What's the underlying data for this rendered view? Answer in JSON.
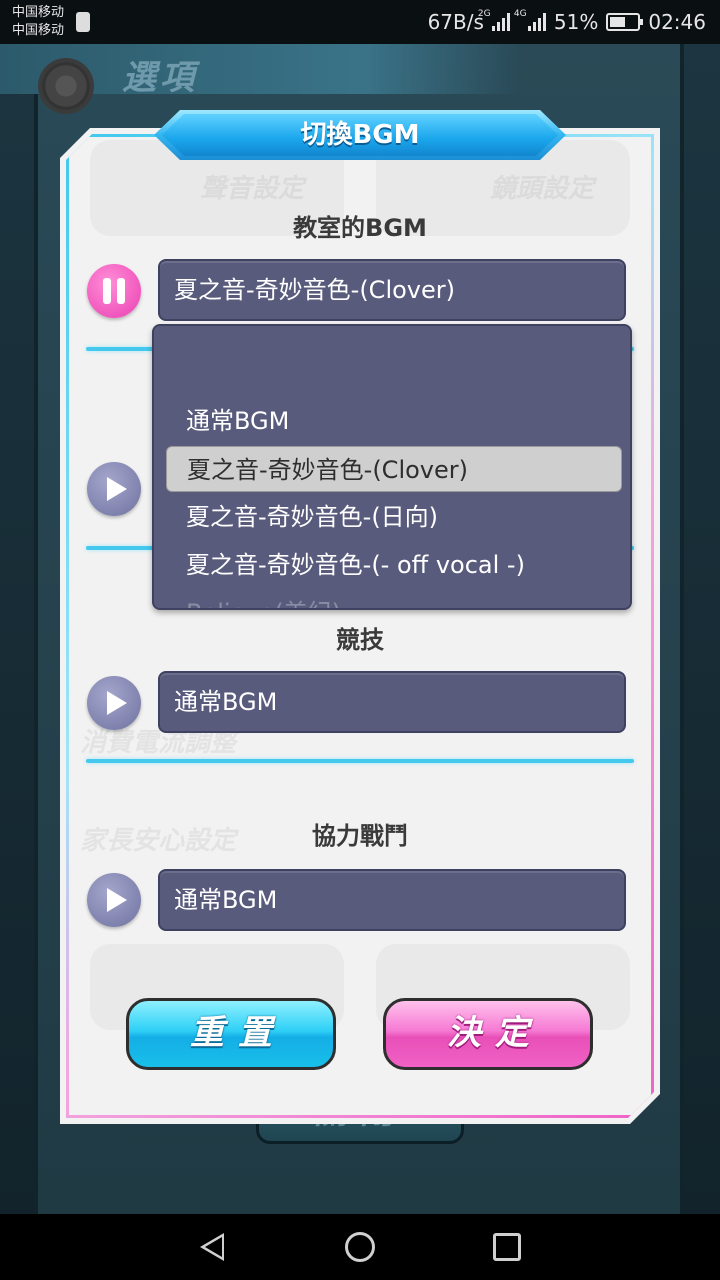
{
  "status_bar": {
    "carrier1": "中国移动",
    "carrier2": "中国移动",
    "net_speed": "67B/s",
    "signal1_tag": "2G",
    "signal2_tag": "4G",
    "battery": "51%",
    "time": "02:46"
  },
  "game": {
    "header_title": "選項",
    "close_label": "關閉",
    "ghost_labels": [
      "聲音設定",
      "鏡頭設定",
      "消費電流調整",
      "家長安心設定"
    ]
  },
  "dialog": {
    "title": "切換BGM",
    "sections": [
      {
        "label": "教室的BGM",
        "value": "夏之音-奇妙音色-(Clover)",
        "state": "playing"
      },
      {
        "label": "",
        "value": "",
        "state": "stopped"
      },
      {
        "label": "競技",
        "value": "通常BGM",
        "state": "stopped"
      },
      {
        "label": "協力戰鬥",
        "value": "通常BGM",
        "state": "stopped"
      }
    ],
    "dropdown": {
      "options": [
        "通常BGM",
        "夏之音-奇妙音色-(Clover)",
        "夏之音-奇妙音色-(日向)",
        "夏之音-奇妙音色-(- off vocal -)",
        "Believe(美紀)"
      ],
      "selected": "夏之音-奇妙音色-(Clover)"
    },
    "reset_label": "重置",
    "ok_label": "決定"
  },
  "colors": {
    "cyan_accent": "#44c8ee",
    "pink_accent": "#f062c8",
    "select_bg": "#595b7d",
    "reset_btn": "#2fd0f6",
    "ok_btn": "#f67ad4"
  },
  "icons": {
    "header": "gear-icon",
    "play": "play-icon",
    "pause": "pause-icon",
    "nav_back": "back-triangle-icon",
    "nav_home": "home-circle-icon",
    "nav_recent": "recent-square-icon"
  }
}
